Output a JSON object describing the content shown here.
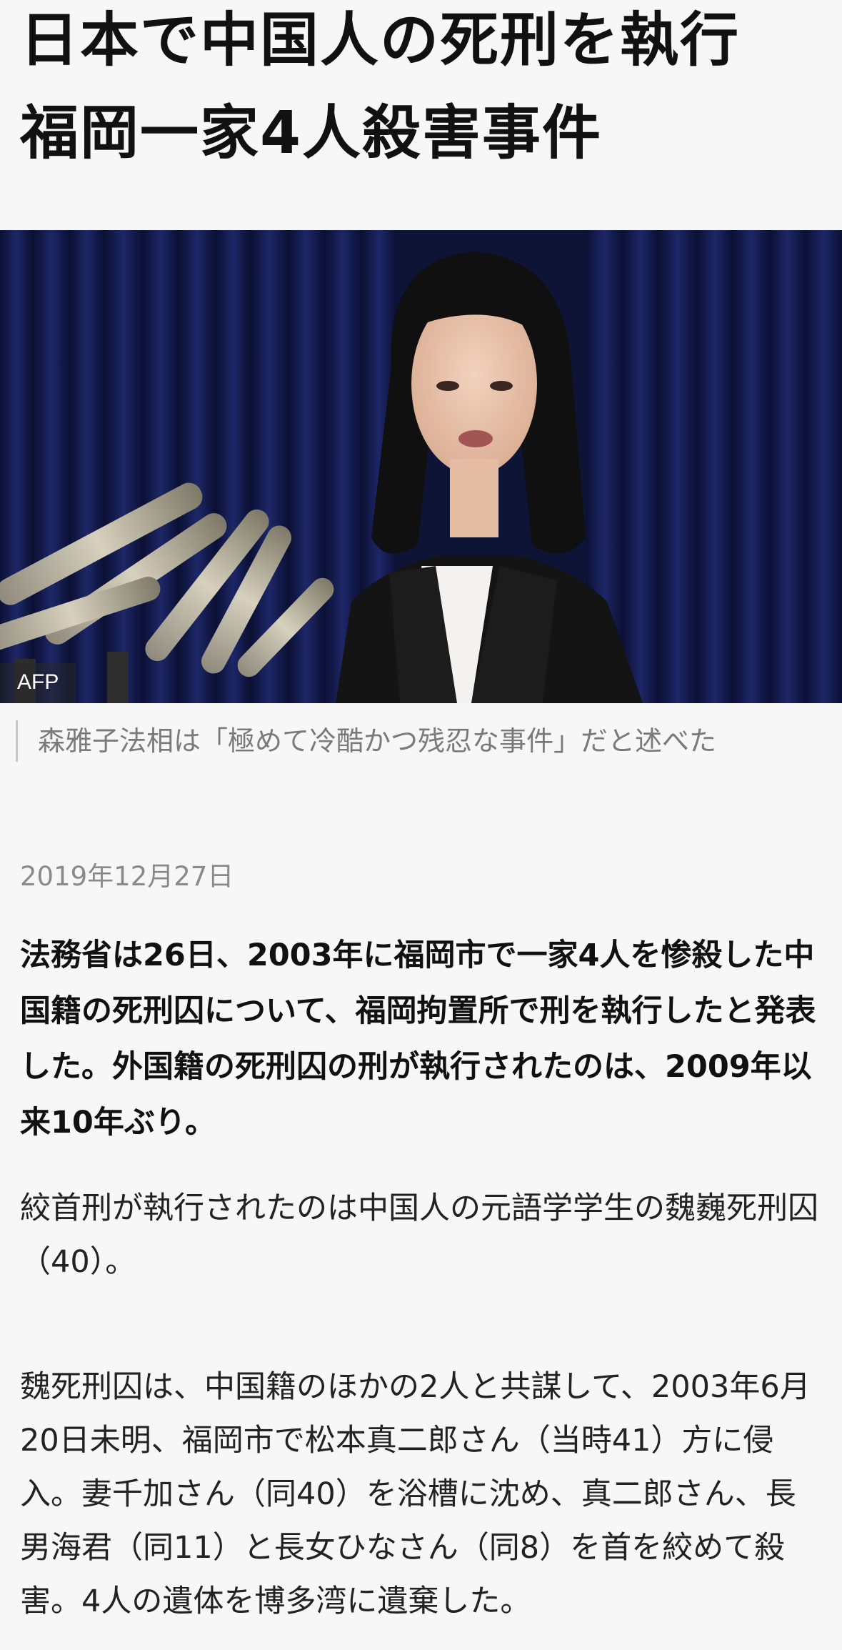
{
  "article": {
    "headline": "日本で中国人の死刑を執行　福岡一家4人殺害事件",
    "photo": {
      "credit": "AFP",
      "caption": "森雅子法相は「極めて冷酷かつ残忍な事件」だと述べた"
    },
    "date": "2019年12月27日",
    "lead": "法務省は26日、2003年に福岡市で一家4人を惨殺した中国籍の死刑囚について、福岡拘置所で刑を執行したと発表した。外国籍の死刑囚の刑が執行されたのは、2009年以来10年ぶり。",
    "paragraphs": [
      "絞首刑が執行されたのは中国人の元語学学生の魏巍死刑囚（40）。",
      "魏死刑囚は、中国籍のほかの2人と共謀して、2003年6月20日未明、福岡市で松本真二郎さん（当時41）方に侵入。妻千加さん（同40）を浴槽に沈め、真二郎さん、長男海君（同11）と長女ひなさん（同8）を首を絞めて殺害。4人の遺体を博多湾に遺棄した。"
    ]
  }
}
